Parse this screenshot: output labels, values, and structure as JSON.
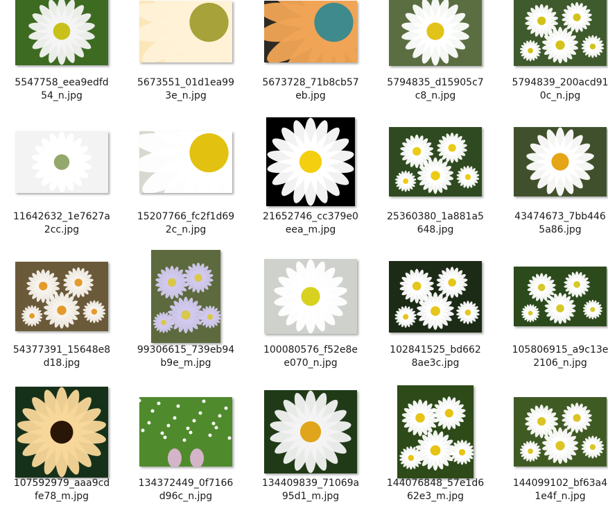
{
  "files": [
    {
      "line1": "5547758_eea9edfd",
      "line2": "54_n.jpg",
      "bg": "#3d6b22",
      "petal": "#f4f4f4",
      "center": "#c9c11a",
      "shape": "daisy",
      "tw": 134,
      "th": 98
    },
    {
      "line1": "5673551_01d1ea99",
      "line2": "3e_n.jpg",
      "bg": "#fbe6b8",
      "petal": "#fff1d6",
      "center": "#a7a23a",
      "shape": "closeup",
      "tw": 134,
      "th": 89
    },
    {
      "line1": "5673728_71b8cb57",
      "line2": "eb.jpg",
      "bg": "#2d2a24",
      "petal": "#f0a455",
      "center": "#3f8a8c",
      "shape": "closeup",
      "tw": 134,
      "th": 89
    },
    {
      "line1": "5794835_d15905c7",
      "line2": "c8_n.jpg",
      "bg": "#5b6e42",
      "petal": "#ffffff",
      "center": "#e2c318",
      "shape": "daisy",
      "tw": 134,
      "th": 100
    },
    {
      "line1": "5794839_200acd91",
      "line2": "0c_n.jpg",
      "bg": "#3f5a2c",
      "petal": "#ffffff",
      "center": "#d4c21a",
      "shape": "cluster",
      "tw": 134,
      "th": 100
    },
    {
      "line1": "11642632_1e7627a",
      "line2": "2cc.jpg",
      "bg": "#f3f3f3",
      "petal": "#ffffff",
      "center": "#93a86a",
      "shape": "daisy",
      "tw": 134,
      "th": 89
    },
    {
      "line1": "15207766_fc2f1d69",
      "line2": "2c_n.jpg",
      "bg": "#d8d8d0",
      "petal": "#ffffff",
      "center": "#e2c111",
      "shape": "closeup",
      "tw": 134,
      "th": 89
    },
    {
      "line1": "21652746_cc379e0",
      "line2": "eea_m.jpg",
      "bg": "#000000",
      "petal": "#ffffff",
      "center": "#f3cf10",
      "shape": "daisy",
      "tw": 128,
      "th": 128
    },
    {
      "line1": "25360380_1a881a5",
      "line2": "648.jpg",
      "bg": "#2f4a20",
      "petal": "#ffffff",
      "center": "#eccb16",
      "shape": "cluster",
      "tw": 134,
      "th": 100
    },
    {
      "line1": "43474673_7bb446",
      "line2": "5a86.jpg",
      "bg": "#40502c",
      "petal": "#ffffff",
      "center": "#e4a517",
      "shape": "daisy",
      "tw": 134,
      "th": 100
    },
    {
      "line1": "54377391_15648e8",
      "line2": "d18.jpg",
      "bg": "#6b5a3a",
      "petal": "#f7f3ec",
      "center": "#e59a2c",
      "shape": "cluster",
      "tw": 134,
      "th": 100
    },
    {
      "line1": "99306615_739eb94",
      "line2": "b9e_m.jpg",
      "bg": "#5c6a3e",
      "petal": "#d2c9ee",
      "center": "#d9c84a",
      "shape": "cluster",
      "tw": 100,
      "th": 134
    },
    {
      "line1": "100080576_f52e8e",
      "line2": "e070_n.jpg",
      "bg": "#cfd2cc",
      "petal": "#ffffff",
      "center": "#d8d11f",
      "shape": "daisy",
      "tw": 134,
      "th": 108
    },
    {
      "line1": "102841525_bd662",
      "line2": "8ae3c.jpg",
      "bg": "#1c2b15",
      "petal": "#ffffff",
      "center": "#e6c51c",
      "shape": "cluster",
      "tw": 134,
      "th": 103
    },
    {
      "line1": "105806915_a9c13e",
      "line2": "2106_n.jpg",
      "bg": "#2c4a1c",
      "petal": "#ffffff",
      "center": "#d7c82a",
      "shape": "cluster",
      "tw": 134,
      "th": 86
    },
    {
      "line1": "107592979_aaa9cd",
      "line2": "fe78_m.jpg",
      "bg": "#16311a",
      "petal": "#f8d79a",
      "center": "#2a1606",
      "shape": "daisy",
      "tw": 134,
      "th": 131
    },
    {
      "line1": "134372449_0f7166",
      "line2": "d96c_n.jpg",
      "bg": "#4f8a2c",
      "petal": "#ffffff",
      "center": "#f1f1f1",
      "shape": "grass",
      "tw": 134,
      "th": 100
    },
    {
      "line1": "134409839_71069a",
      "line2": "95d1_m.jpg",
      "bg": "#203a18",
      "petal": "#f3f3f3",
      "center": "#e0a51b",
      "shape": "daisy",
      "tw": 134,
      "th": 120
    },
    {
      "line1": "144076848_57e1d6",
      "line2": "62e3_m.jpg",
      "bg": "#2d4a18",
      "petal": "#ffffff",
      "center": "#e7c313",
      "shape": "cluster",
      "tw": 110,
      "th": 134
    },
    {
      "line1": "144099102_bf63a4",
      "line2": "1e4f_n.jpg",
      "bg": "#405a24",
      "petal": "#ffffff",
      "center": "#dcc424",
      "shape": "cluster",
      "tw": 134,
      "th": 100
    }
  ]
}
